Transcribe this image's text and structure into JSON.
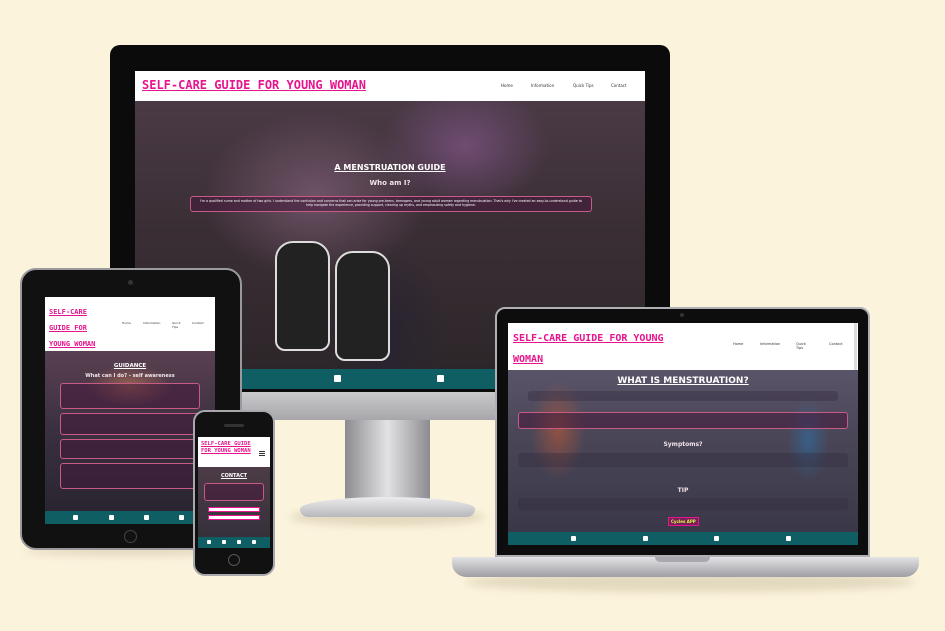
{
  "monitor": {
    "site_title": "SELF-CARE GUIDE FOR YOUNG WOMAN",
    "nav": [
      "Home",
      "Information",
      "Quick Tips",
      "Contact"
    ],
    "hero_heading": "A MENSTRUATION GUIDE",
    "hero_subheading": "Who am I?",
    "hero_text": "I'm a qualified nurse and mother of two girls. I understand the confusion and concerns that can arise for young pre-teens, teenagers, and young adult women regarding menstruation. That's why I've created an easy-to-understand guide to help navigate the experience, providing support, clearing up myths, and emphasizing safety and hygiene.",
    "footer_icons": [
      "twitter-icon",
      "youtube-icon"
    ]
  },
  "tablet": {
    "site_title": "SELF-CARE GUIDE FOR YOUNG WOMAN",
    "nav": [
      "Home",
      "Information",
      "Quick Tips",
      "Contact"
    ],
    "hero_heading": "GUIDANCE",
    "hero_subheading": "What can I do? - self awareness",
    "footer_icons": [
      "facebook-icon",
      "twitter-icon",
      "youtube-icon",
      "instagram-icon"
    ]
  },
  "phone": {
    "site_title": "SELF-CARE GUIDE FOR YOUNG WOMAN",
    "menu_icon": "hamburger-icon",
    "hero_heading": "CONTACT",
    "footer_icons": [
      "facebook-icon",
      "twitter-icon",
      "youtube-icon",
      "instagram-icon"
    ]
  },
  "laptop": {
    "site_title": "SELF-CARE GUIDE FOR YOUNG WOMAN",
    "nav": [
      "Home",
      "Information",
      "Quick Tips",
      "Contact"
    ],
    "section1_heading": "WHAT IS MENSTRUATION?",
    "section2_heading": "Symptoms?",
    "section3_heading": "TIP",
    "tip_button": "Cycles APP",
    "footer_icons": [
      "facebook-icon",
      "twitter-icon",
      "youtube-icon",
      "instagram-icon"
    ]
  },
  "colors": {
    "background": "#fbf3dc",
    "title_pink": "#e6148d",
    "footer_teal": "#0e5e63",
    "box_border": "#c85a86"
  }
}
